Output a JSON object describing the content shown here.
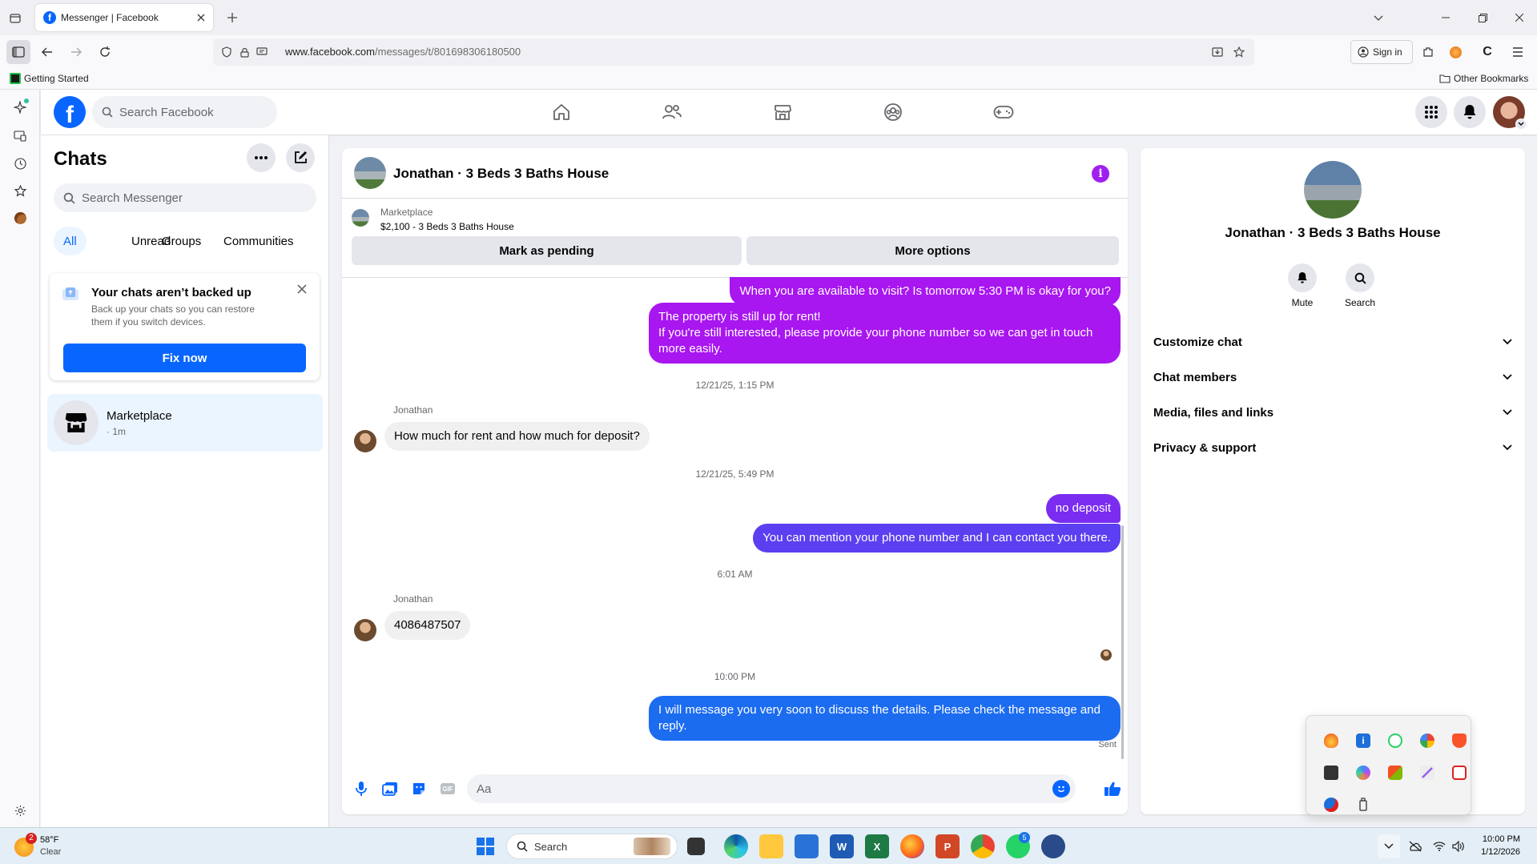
{
  "browser": {
    "tab_title": "Messenger | Facebook",
    "url_host": "www.facebook.com",
    "url_path": "/messages/t/801698306180500",
    "sign_in": "Sign in",
    "bookmark_getting_started": "Getting Started",
    "bookmark_other": "Other Bookmarks"
  },
  "fb": {
    "search_placeholder": "Search Facebook",
    "brand_color": "#0866ff"
  },
  "chats": {
    "title": "Chats",
    "search_placeholder": "Search Messenger",
    "filters": [
      "All",
      "Unread",
      "Groups",
      "Communities"
    ],
    "backup_card": {
      "title": "Your chats aren’t backed up",
      "body_line1": "Back up your chats so you can restore",
      "body_line2": "them if you switch devices.",
      "button": "Fix now"
    },
    "items": [
      {
        "name": "Marketplace",
        "meta": "· 1m"
      }
    ]
  },
  "conversation": {
    "title": "Jonathan · 3 Beds 3 Baths House",
    "listing_label": "Marketplace",
    "listing_detail": "$2,100 - 3 Beds 3 Baths House",
    "mark_pending": "Mark as pending",
    "more_options": "More options",
    "messages": {
      "m1": "When you are available to visit? Is tomorrow 5:30 PM is okay for you?",
      "m2_l1": "The property is still up for rent!",
      "m2_l2": "If you're still interested, please provide your phone number so we can get in touch",
      "m2_l3": "more easily.",
      "t1": "12/21/25, 1:15 PM",
      "sender1": "Jonathan",
      "m3": "How much for rent and how much for deposit?",
      "t2": "12/21/25, 5:49 PM",
      "m4": "no deposit",
      "m5": "You can mention your phone number and I can contact you there.",
      "t3": "6:01 AM",
      "sender2": "Jonathan",
      "m6": "4086487507",
      "t4": "10:00 PM",
      "m7_l1": "I will message you very soon to discuss the details. Please check the message and",
      "m7_l2": "reply.",
      "status": "Sent"
    },
    "composer_placeholder": "Aa"
  },
  "info": {
    "name": "Jonathan · 3 Beds 3 Baths House",
    "mute": "Mute",
    "search": "Search",
    "sections": [
      "Customize chat",
      "Chat members",
      "Media, files and links",
      "Privacy & support"
    ]
  },
  "taskbar": {
    "weather_temp": "58°F",
    "weather_desc": "Clear",
    "weather_badge": "2",
    "search_label": "Search",
    "time": "10:00 PM",
    "date": "1/12/2026",
    "whatsapp_badge": "5"
  }
}
